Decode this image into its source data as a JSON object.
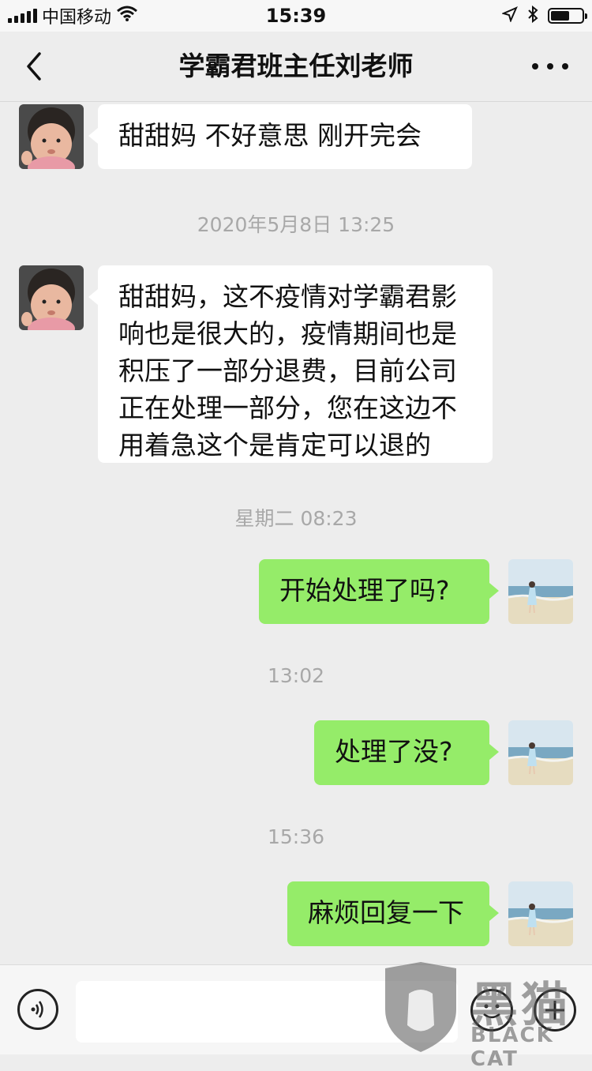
{
  "status_bar": {
    "carrier": "中国移动",
    "time": "15:39"
  },
  "nav": {
    "title": "学霸君班主任刘老师"
  },
  "messages": [
    {
      "side": "in",
      "text": "甜甜妈  不好意思  刚开完会"
    },
    {
      "timestamp": "2020年5月8日 13:25"
    },
    {
      "side": "in",
      "text": "甜甜妈，这不疫情对学霸君影响也是很大的，疫情期间也是积压了一部分退费，目前公司正在处理一部分，您在这边不用着急这个是肯定可以退的"
    },
    {
      "timestamp": "星期二 08:23"
    },
    {
      "side": "out",
      "text": "开始处理了吗?"
    },
    {
      "timestamp": "13:02"
    },
    {
      "side": "out",
      "text": "处理了没?"
    },
    {
      "timestamp": "15:36"
    },
    {
      "side": "out",
      "text": "麻烦回复一下"
    }
  ],
  "input_bar": {
    "icons": [
      "voice-icon",
      "emoji-icon",
      "plus-icon"
    ]
  },
  "watermark": {
    "cn": "黑猫",
    "en": "BLACK CAT"
  },
  "colors": {
    "incoming_bubble": "#ffffff",
    "outgoing_bubble": "#95ec69",
    "chat_background": "#ededed",
    "timestamp_text": "#a8a8a8"
  }
}
